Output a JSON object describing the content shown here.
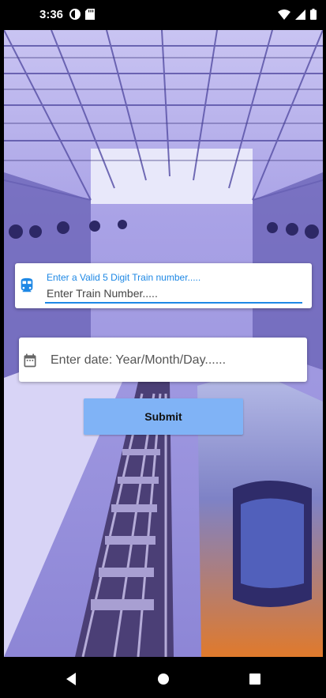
{
  "status_bar": {
    "time": "3:36",
    "left_icons": [
      "data-saver-icon",
      "sd-card-icon"
    ],
    "right_icons": [
      "wifi-icon",
      "signal-icon",
      "battery-icon"
    ]
  },
  "background": {
    "icon": "train-station-photo"
  },
  "train_field": {
    "label": "Enter a Valid 5 Digit Train number.....",
    "placeholder": "Enter Train Number.....",
    "value": "",
    "icon": "train-icon",
    "accent": "#1e88e5"
  },
  "date_field": {
    "placeholder": "Enter date: Year/Month/Day......",
    "value": "",
    "icon": "calendar-icon"
  },
  "submit": {
    "label": "Submit",
    "color": "#80b3f6"
  },
  "nav_bar": {
    "icons": [
      "back-icon",
      "home-icon",
      "recents-icon"
    ]
  }
}
